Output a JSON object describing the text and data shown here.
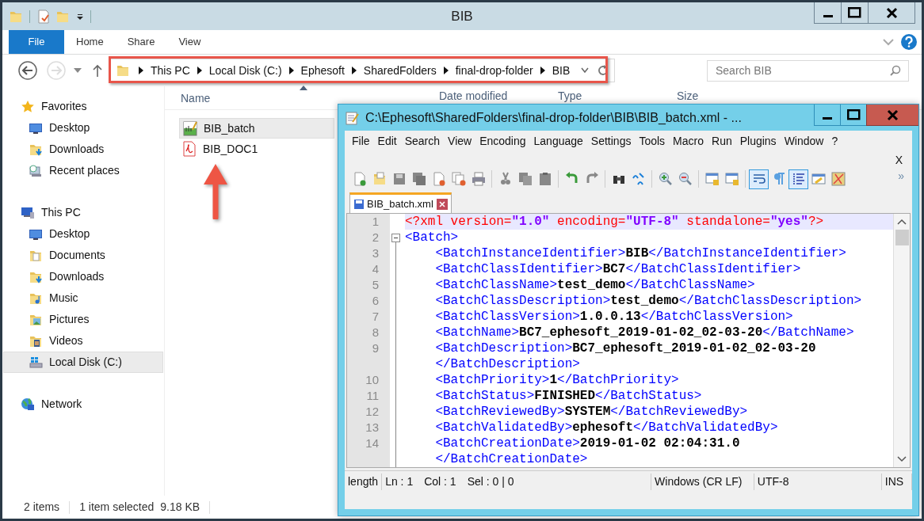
{
  "explorer": {
    "title": "BIB",
    "ribbon_tabs": [
      {
        "label": "File",
        "selected": true
      },
      {
        "label": "Home",
        "selected": false
      },
      {
        "label": "Share",
        "selected": false
      },
      {
        "label": "View",
        "selected": false
      }
    ],
    "breadcrumb": [
      "This PC",
      "Local Disk (C:)",
      "Ephesoft",
      "SharedFolders",
      "final-drop-folder",
      "BIB"
    ],
    "search": {
      "placeholder": "Search BIB"
    },
    "navigation": [
      {
        "label": "Favorites",
        "kind": "favorites",
        "selected": false,
        "children": [
          {
            "label": "Desktop",
            "kind": "desktop",
            "selected": false
          },
          {
            "label": "Downloads",
            "kind": "downloads",
            "selected": false
          },
          {
            "label": "Recent places",
            "kind": "recent",
            "selected": false
          }
        ]
      },
      {
        "label": "This PC",
        "kind": "pc",
        "selected": false,
        "children": [
          {
            "label": "Desktop",
            "kind": "desktop",
            "selected": false
          },
          {
            "label": "Documents",
            "kind": "documents",
            "selected": false
          },
          {
            "label": "Downloads",
            "kind": "downloads",
            "selected": false
          },
          {
            "label": "Music",
            "kind": "music",
            "selected": false
          },
          {
            "label": "Pictures",
            "kind": "pictures",
            "selected": false
          },
          {
            "label": "Videos",
            "kind": "videos",
            "selected": false
          },
          {
            "label": "Local Disk (C:)",
            "kind": "drive",
            "selected": true
          }
        ]
      },
      {
        "label": "Network",
        "kind": "network",
        "selected": false
      }
    ],
    "columns": [
      "Name",
      "Date modified",
      "Type",
      "Size"
    ],
    "files": [
      {
        "name": "BIB_batch",
        "kind": "xml",
        "selected": true
      },
      {
        "name": "BIB_DOC1",
        "kind": "pdf",
        "selected": false
      }
    ],
    "status_bar": {
      "count": "2 items",
      "selection": "1 item selected",
      "size": "9.18 KB"
    }
  },
  "editor": {
    "title": "C:\\Ephesoft\\SharedFolders\\final-drop-folder\\BIB\\BIB_batch.xml - ...",
    "menu": [
      "File",
      "Edit",
      "Search",
      "View",
      "Encoding",
      "Language",
      "Settings",
      "Tools",
      "Macro",
      "Run",
      "Plugins",
      "Window",
      "?"
    ],
    "close_label": "X",
    "toolbar": [
      {
        "pressed": false
      },
      {
        "pressed": false
      },
      {
        "pressed": false
      },
      {
        "pressed": false
      },
      {
        "pressed": false
      },
      {
        "pressed": false
      },
      {
        "pressed": false
      },
      {
        "pressed": false
      },
      {
        "pressed": false
      },
      {
        "pressed": false
      },
      {
        "pressed": false
      },
      {
        "pressed": false
      },
      {
        "pressed": false
      },
      {
        "pressed": false
      },
      {
        "pressed": false
      },
      {
        "pressed": false
      },
      {
        "pressed": false
      },
      {
        "pressed": false
      },
      {
        "pressed": true
      },
      {
        "pressed": false
      },
      {
        "pressed": true
      },
      {
        "pressed": false
      },
      {
        "pressed": false
      }
    ],
    "overflow": "»",
    "tabs": [
      {
        "label": "BIB_batch.xml",
        "selected": true
      }
    ],
    "lines": [
      {
        "number": "1",
        "text": "<?xml version=\"1.0\" encoding=\"UTF-8\" standalone=\"yes\"?>",
        "current": true
      },
      {
        "number": "2",
        "text": "<Batch>",
        "current": false
      },
      {
        "number": "3",
        "text": "    <BatchInstanceIdentifier>BIB</BatchInstanceIdentifier>",
        "current": false
      },
      {
        "number": "4",
        "text": "    <BatchClassIdentifier>BC7</BatchClassIdentifier>",
        "current": false
      },
      {
        "number": "5",
        "text": "    <BatchClassName>test_demo</BatchClassName>",
        "current": false
      },
      {
        "number": "6",
        "text": "    <BatchClassDescription>test_demo</BatchClassDescription>",
        "current": false
      },
      {
        "number": "7",
        "text": "    <BatchClassVersion>1.0.0.13</BatchClassVersion>",
        "current": false
      },
      {
        "number": "8",
        "text": "    <BatchName>BC7_ephesoft_2019-01-02_02-03-20</BatchName>",
        "current": false
      },
      {
        "number": "9",
        "text": "    <BatchDescription>BC7_ephesoft_2019-01-02_02-03-20",
        "current": false
      },
      {
        "text": "    </BatchDescription>",
        "current": false
      },
      {
        "number": "10",
        "text": "    <BatchPriority>1</BatchPriority>",
        "current": false
      },
      {
        "number": "11",
        "text": "    <BatchStatus>FINISHED</BatchStatus>",
        "current": false
      },
      {
        "number": "12",
        "text": "    <BatchReviewedBy>SYSTEM</BatchReviewedBy>",
        "current": false
      },
      {
        "number": "13",
        "text": "    <BatchValidatedBy>ephesoft</BatchValidatedBy>",
        "current": false
      },
      {
        "number": "14",
        "text": "    <BatchCreationDate>2019-01-02 02:04:31.0",
        "current": false
      },
      {
        "text": "    </BatchCreationDate>",
        "current": false
      }
    ],
    "status_bar": [
      "length",
      "Ln : 1",
      "Col : 1",
      "Sel : 0 | 0",
      "Windows (CR LF)",
      "UTF-8",
      "INS"
    ]
  }
}
